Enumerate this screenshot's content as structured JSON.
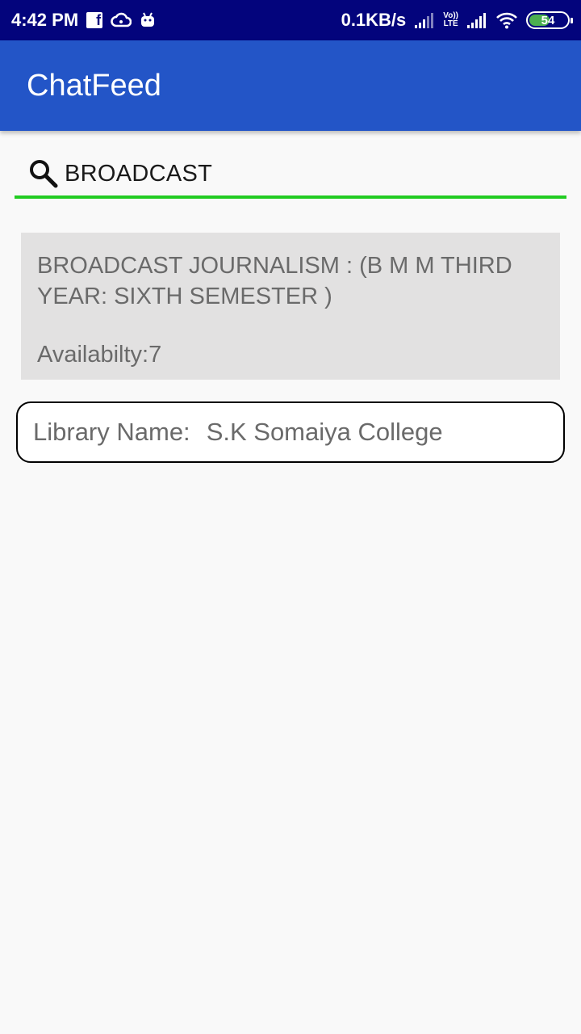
{
  "status_bar": {
    "time": "4:42 PM",
    "network_speed": "0.1KB/s",
    "volte_label": "Vo))",
    "lte_label": "LTE",
    "battery": "54",
    "battery_level_pct": 54,
    "icons": [
      "facebook-icon",
      "cloud-icon",
      "android-icon",
      "signal-icon",
      "signal-icon",
      "wifi-icon",
      "battery-icon"
    ]
  },
  "app_bar": {
    "title": "ChatFeed",
    "color": "#2355c7"
  },
  "search": {
    "value": "BROADCAST",
    "underline_color": "#22cc22"
  },
  "result": {
    "title": "BROADCAST JOURNALISM : (B M M THIRD YEAR: SIXTH SEMESTER )",
    "availability_label": "Availabilty:",
    "availability_value": "7"
  },
  "library": {
    "label": "Library Name:",
    "name": "S.K Somaiya College"
  }
}
